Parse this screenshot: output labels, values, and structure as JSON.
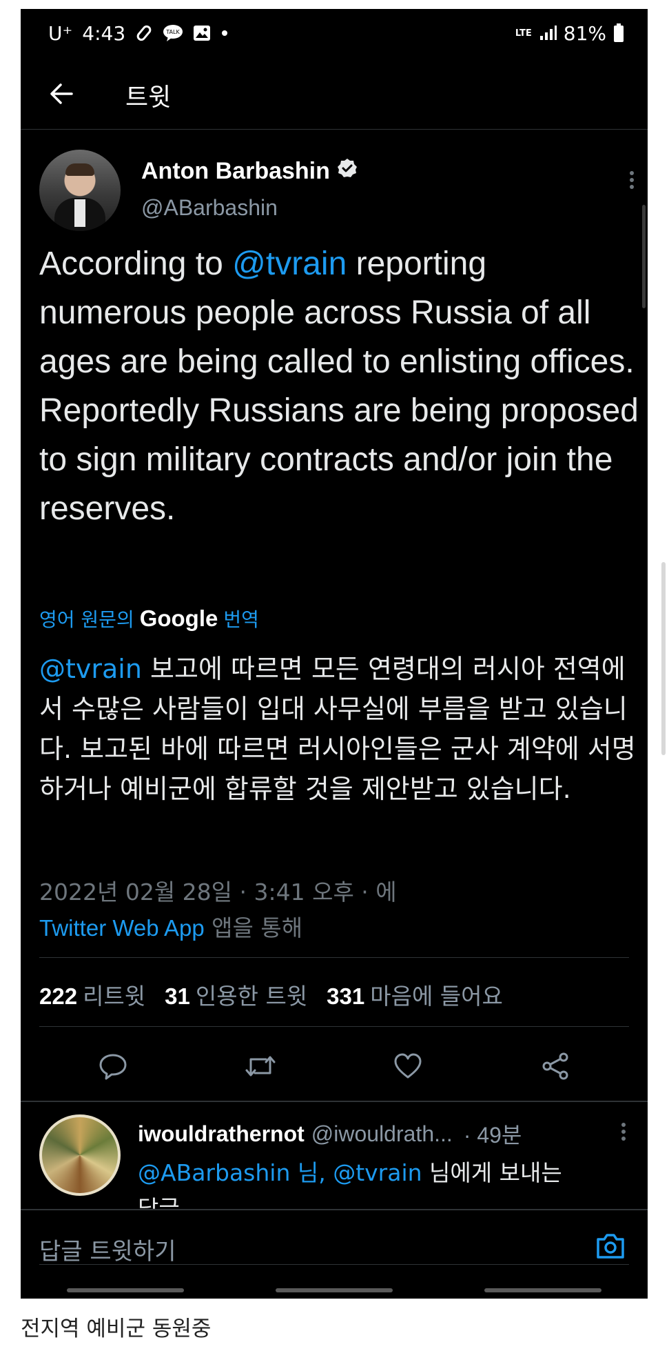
{
  "status_bar": {
    "carrier": "U⁺",
    "time": "4:43",
    "network": "LTE",
    "battery": "81%",
    "icons": [
      "clip-icon",
      "talk-icon",
      "image-icon",
      "dot-icon",
      "signal-icon",
      "battery-icon"
    ]
  },
  "header": {
    "title": "트윗"
  },
  "tweet": {
    "author_name": "Anton Barbashin",
    "author_handle": "@ABarbashin",
    "text_prefix": "According to ",
    "text_mention": "@tvrain",
    "text_rest": " reporting numerous people across Russia of all ages are being called to enlisting offices. Reportedly Russians are being proposed to sign military contracts and/or join the reserves.",
    "translate_prefix": "영어 원문의",
    "translate_google": "Google",
    "translate_suffix": "번역",
    "translated_mention": "@tvrain",
    "translated_text": " 보고에 따르면 모든 연령대의 러시아 전역에서 수많은 사람들이 입대 사무실에 부름을 받고 있습니다. 보고된 바에 따르면 러시아인들은 군사 계약에 서명하거나 예비군에 합류할 것을 제안받고 있습니다.",
    "date_line": "2022년 02월 28일 · 3:41 오후 · 에",
    "source_app": "Twitter Web App",
    "source_suffix": " 앱을 통해"
  },
  "stats": {
    "retweets_count": "222",
    "retweets_label": "리트윗",
    "quotes_count": "31",
    "quotes_label": "인용한 트윗",
    "likes_count": "331",
    "likes_label": "마음에 들어요"
  },
  "actions": [
    "reply-icon",
    "retweet-icon",
    "like-icon",
    "share-icon"
  ],
  "reply": {
    "name": "iwouldrathernot",
    "handle": "@iwouldrath...",
    "time": "· 49분",
    "text_mention1": "@ABarbashin",
    "text_mid1": " 님, ",
    "text_mention2": "@tvrain",
    "text_mid2": " 님에게 보내는",
    "text_line2": "답글"
  },
  "compose": {
    "placeholder": "답글 트윗하기"
  },
  "caption": "전지역 예비군 동원중",
  "colors": {
    "background": "#000000",
    "accent": "#1d9bf0",
    "text": "#e7e9ea",
    "muted": "#8b98a5"
  }
}
